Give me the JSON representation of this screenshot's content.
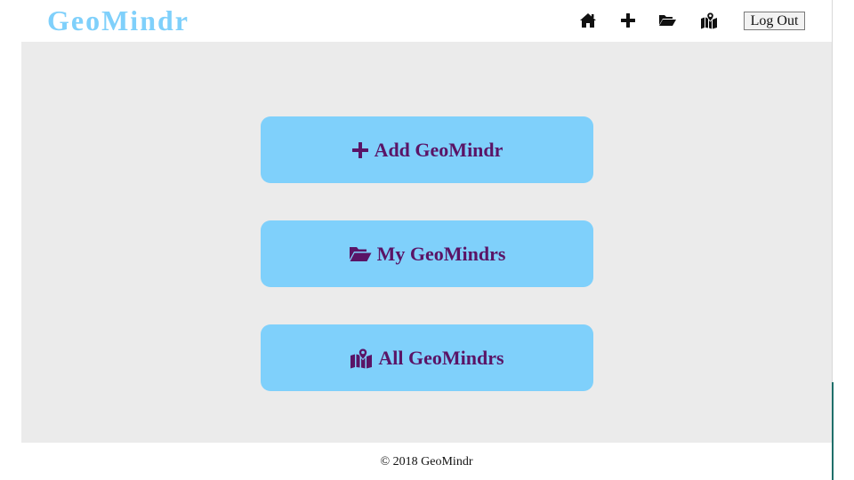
{
  "header": {
    "brand": "GeoMindr",
    "nav_icons": [
      "home-icon",
      "plus-icon",
      "folder-open-icon",
      "map-marked-icon"
    ],
    "logout_label": "Log Out"
  },
  "actions": [
    {
      "icon": "plus-icon",
      "label": "Add GeoMindr"
    },
    {
      "icon": "folder-open-icon",
      "label": "My GeoMindrs"
    },
    {
      "icon": "map-marked-icon",
      "label": "All GeoMindrs"
    }
  ],
  "footer": {
    "copyright": "© 2018 GeoMindr"
  },
  "colors": {
    "brand": "#7fd0fb",
    "button_bg": "#7fd0fb",
    "button_text": "#5a1466",
    "main_bg": "#ebebeb",
    "icon": "#111111"
  }
}
